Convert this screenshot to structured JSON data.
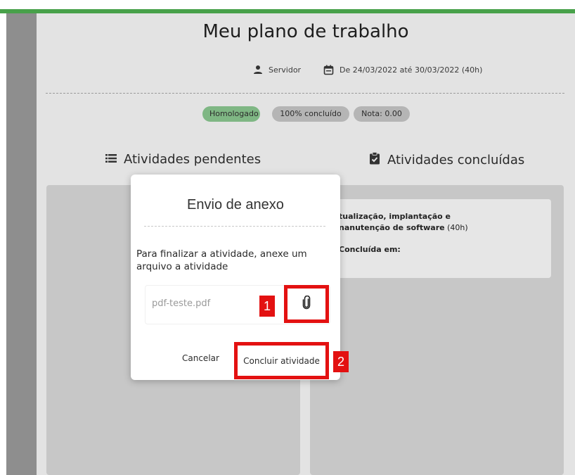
{
  "page": {
    "title": "Meu plano de trabalho",
    "role": "Servidor",
    "period": "De 24/03/2022 até 30/03/2022 (40h)",
    "badges": {
      "status": "Homologado",
      "progress": "100% concluído",
      "grade": "Nota: 0.00"
    },
    "columns": {
      "pending": "Atividades pendentes",
      "done": "Atividades concluídas"
    }
  },
  "activity_card": {
    "name": "tualização, implantação e",
    "name_line2": "nanutenção de software",
    "hours": "(40h)",
    "completed_label": "Concluída em:"
  },
  "modal": {
    "title": "Envio de anexo",
    "message": "Para finalizar a atividade, anexe um arquivo a atividade",
    "file_value": "pdf-teste.pdf",
    "cancel_label": "Cancelar",
    "submit_label": "Concluir atividade",
    "markers": [
      "1",
      "2"
    ],
    "highlight_color": "#e31111"
  },
  "colors": {
    "accent": "#48a14a",
    "badge_green": "#7fb784"
  },
  "icons": {
    "person": "person-icon",
    "calendar": "calendar-icon",
    "list": "list-icon",
    "clipboard": "clipboard-check-icon",
    "attach": "paperclip-icon"
  }
}
